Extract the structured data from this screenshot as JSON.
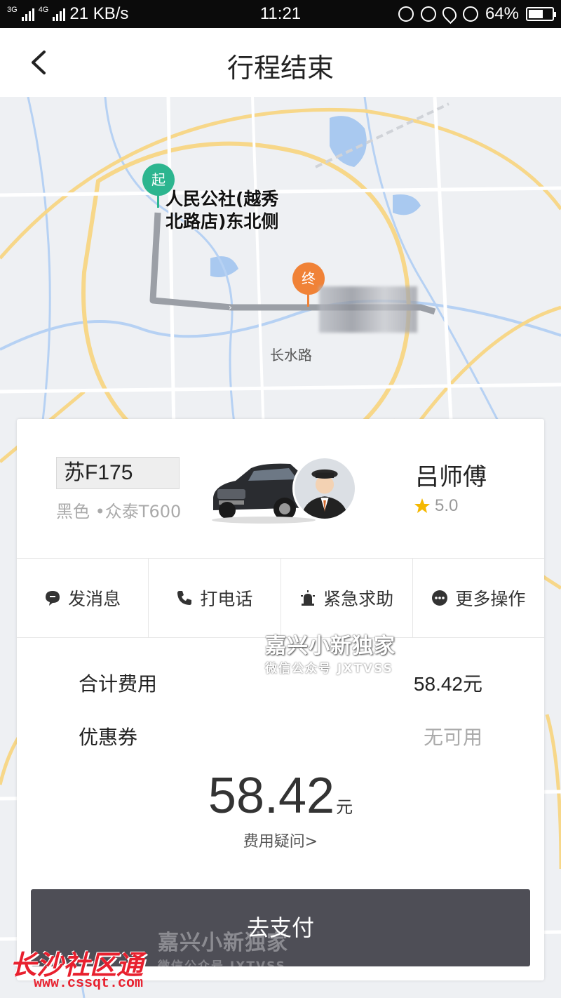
{
  "status_bar": {
    "network_1": "3G",
    "network_2": "4G",
    "speed": "21 KB/s",
    "time": "11:21",
    "battery": "64%",
    "battery_level": 0.64
  },
  "header": {
    "title": "行程结束"
  },
  "map": {
    "start_pin": "起",
    "end_pin": "终",
    "start_label_line1": "人民公社(越秀",
    "start_label_line2": "北路店)东北侧",
    "road_label": "长水路"
  },
  "trip": {
    "plate": "苏F175",
    "car_desc": "黑色 •众泰T600",
    "driver_name": "吕师傅",
    "rating": "5.0"
  },
  "actions": [
    {
      "label": "发消息",
      "icon": "message-icon"
    },
    {
      "label": "打电话",
      "icon": "phone-icon"
    },
    {
      "label": "紧急求助",
      "icon": "alarm-icon"
    },
    {
      "label": "更多操作",
      "icon": "more-icon"
    }
  ],
  "fare": {
    "total_label": "合计费用",
    "total_value": "58.42元",
    "coupon_label": "优惠券",
    "coupon_value": "无可用",
    "amount": "58.42",
    "unit": "元",
    "question": "费用疑问>"
  },
  "pay_button": "去支付",
  "watermarks": {
    "title": "嘉兴小新独家",
    "subtitle": "微信公众号 JXTVSS",
    "site_name": "长沙社区通",
    "site_url": "www.cssqt.com"
  },
  "colors": {
    "start": "#2cb58f",
    "end": "#f08237",
    "pay_button": "#4e4e56",
    "star": "#f5b800"
  }
}
